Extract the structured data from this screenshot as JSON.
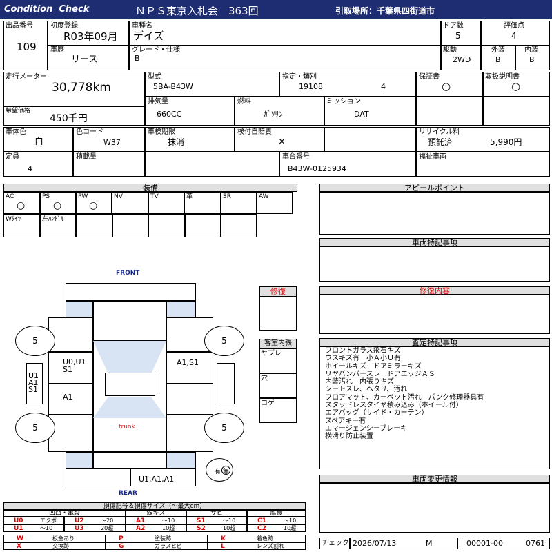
{
  "header": {
    "brand": "Condition  Check",
    "auction": "ＮＰＳ東京入札会　363回",
    "pickup": "引取場所：千葉県四街道市"
  },
  "top": {
    "lot_label": "出品番号",
    "lot": "109",
    "first_reg_label": "初度登録",
    "first_reg": "R03年09月",
    "name_label": "車種名",
    "name": "デイズ",
    "doors_label": "ドア数",
    "doors": "5",
    "score_label": "評価点",
    "score": "4",
    "history_label": "車歴",
    "history": "リース",
    "grade_label": "グレード・仕様",
    "grade": "B",
    "drive_label": "駆動",
    "drive": "2WD",
    "ext_label": "外装",
    "ext": "B",
    "int_label": "内装",
    "int": "B"
  },
  "specs": {
    "mileage_label": "走行メーター",
    "mileage": "30,778km",
    "model_label": "型式",
    "model": "5BA-B43W",
    "designation_label": "指定・類別",
    "designation": "19108",
    "category": "4",
    "warranty_label": "保証書",
    "warranty": "○",
    "manual_label": "取扱説明書",
    "manual": "○",
    "price_label": "希望価格",
    "price": "450千円",
    "displacement_label": "排気量",
    "displacement": "660CC",
    "fuel_label": "燃料",
    "fuel": "ｶﾞｿﾘﾝ",
    "transmission_label": "ミッション",
    "transmission": "DAT",
    "body_color_label": "車体色",
    "body_color": "白",
    "color_code_label": "色コード",
    "color_code": "W37",
    "inspection_label": "車検期限",
    "inspection": "抹消",
    "liability_label": "検付自賠責",
    "liability": "×",
    "recycle_label": "リサイクル料",
    "recycle_status": "預託済",
    "recycle_amount": "5,990円",
    "capacity_label": "定員",
    "capacity": "4",
    "load_label": "積載量",
    "load": "",
    "chassis_label": "車台番号",
    "chassis": "B43W-0125934",
    "welfare_label": "福祉車両",
    "welfare": ""
  },
  "equipment": {
    "title": "装備",
    "row1": [
      {
        "label": "AC",
        "value": "○"
      },
      {
        "label": "PS",
        "value": "○"
      },
      {
        "label": "PW",
        "value": "○"
      },
      {
        "label": "NV",
        "value": ""
      },
      {
        "label": "TV",
        "value": ""
      },
      {
        "label": "革",
        "value": ""
      },
      {
        "label": "SR",
        "value": ""
      },
      {
        "label": "AW",
        "value": ""
      }
    ],
    "row2": [
      {
        "label": "Wﾀｲﾔ"
      },
      {
        "label": "左ﾊﾝﾄﾞﾙ"
      },
      {
        "label": ""
      },
      {
        "label": ""
      },
      {
        "label": ""
      },
      {
        "label": ""
      },
      {
        "label": ""
      }
    ]
  },
  "diagram": {
    "front": "FRONT",
    "rear": "REAR",
    "trunk": "trunk",
    "tires": [
      "5",
      "5",
      "5",
      "5"
    ],
    "damage": {
      "front_left_door": "U0,U1\nS1",
      "front_right_door": "A1,S1",
      "left_side": "U1\nA1\nS1",
      "rear_left_door": "A1",
      "rear_bumper": "U1,A1,A1"
    },
    "spare_have": "有",
    "spare_none": "無"
  },
  "repair": {
    "title": "修復",
    "value": ""
  },
  "interior": {
    "title": "客室内張",
    "items": [
      "ヤブレ",
      "穴",
      "コゲ"
    ]
  },
  "right_sections": {
    "appeal_title": "アピールポイント",
    "vehicle_notes_title": "車両特記事項",
    "repair_content_title": "修復内容",
    "inspection_notes_title": "査定特記事項",
    "inspection_notes": [
      "フロントガラス飛石キズ",
      "ウスキズ有　小Ａ小Ｕ有",
      "ホイールキズ　ドアミラーキズ",
      "リヤバンパースレ　ドアエッジＡＳ",
      "内装汚れ　内張りキズ",
      "シートスレ、ヘタリ、汚れ",
      "フロアマット、カーペット汚れ　パンク修理器具有",
      "スタッドレスタイヤ積み込み（ホイール付）",
      "エアバッグ（サイド・カーテン）",
      "スペアキー有",
      "エマージェンシーブレーキ",
      "横滑り防止装置"
    ],
    "change_info_title": "車両変更情報"
  },
  "legend": {
    "title": "損傷記号＆損傷サイズ（～最大cm）",
    "groups": [
      "凹凸・亀裂",
      "線キズ",
      "サビ",
      "腐食"
    ],
    "rows": [
      [
        [
          "U0",
          "エクボ"
        ],
        [
          "U2",
          "～20"
        ],
        [
          "A1",
          "～10"
        ],
        [
          "S1",
          "～10"
        ],
        [
          "C1",
          "～10"
        ]
      ],
      [
        [
          "U1",
          "～10"
        ],
        [
          "U3",
          "20超"
        ],
        [
          "A2",
          "10超"
        ],
        [
          "S2",
          "10超"
        ],
        [
          "C2",
          "10超"
        ]
      ]
    ],
    "symbols": [
      [
        [
          "W",
          "板金あり"
        ],
        [
          "P",
          "塗装跡"
        ],
        [
          "K",
          "着色跡"
        ]
      ],
      [
        [
          "X",
          "交換跡"
        ],
        [
          "G",
          "ガラスヒビ"
        ],
        [
          "L",
          "レンズ割れ"
        ]
      ]
    ]
  },
  "footer": {
    "check_label": "チェック",
    "date": "2026/07/13",
    "inspector": "M",
    "code": "00001-00",
    "number": "0761"
  }
}
